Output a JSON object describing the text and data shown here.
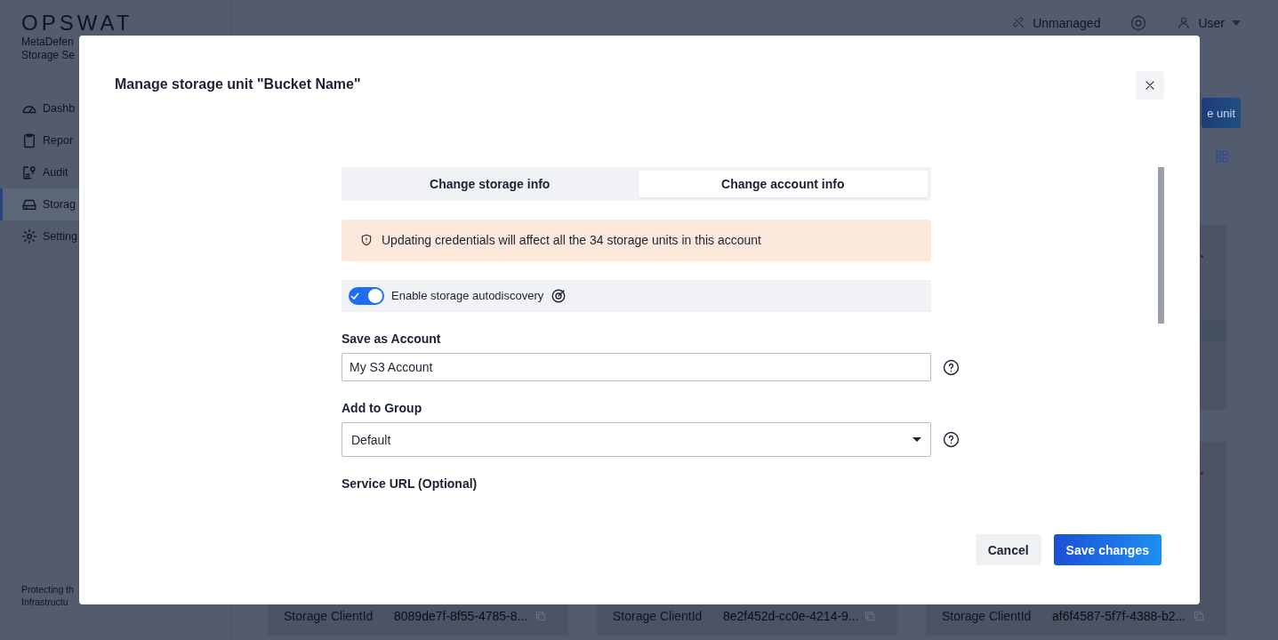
{
  "sidebar": {
    "logo": "OPSWAT",
    "product_lines": [
      "MetaDefen",
      "Storage Se"
    ],
    "items": [
      {
        "label": "Dashb",
        "selected": false
      },
      {
        "label": "Repor",
        "selected": false
      },
      {
        "label": "Audit",
        "selected": false
      },
      {
        "label": "Storag",
        "selected": true
      },
      {
        "label": "Setting",
        "selected": false
      }
    ],
    "footer_lines": [
      "Protecting th",
      "Infrastructu"
    ]
  },
  "header": {
    "mode": "Unmanaged",
    "user": "User"
  },
  "toolbar": {
    "add_button": "e unit"
  },
  "cards": [
    {
      "fields": [
        {
          "label": "Storage ClientId",
          "value": "8089de7f-8f55-4785-8..."
        }
      ]
    },
    {
      "fields": [
        {
          "label": "Storage ClientId",
          "value": "8e2f452d-cc0e-4214-9..."
        }
      ]
    },
    {
      "fields": [
        {
          "label": "Storage ClientId",
          "value": "af6f4587-5f7f-4388-b2..."
        }
      ]
    }
  ],
  "modal": {
    "title": "Manage storage unit \"Bucket Name\"",
    "tabs": [
      {
        "label": "Change storage info",
        "selected": false
      },
      {
        "label": "Change account info",
        "selected": true
      }
    ],
    "alert": "Updating credentials will affect all the 34 storage units in this account",
    "toggle": {
      "label": "Enable storage autodiscovery",
      "on": true
    },
    "fields": [
      {
        "kind": "text",
        "label": "Save as Account",
        "value": "My S3 Account"
      },
      {
        "kind": "select",
        "label": "Add to Group",
        "value": "Default"
      },
      {
        "kind": "label",
        "label": "Service URL (Optional)"
      }
    ],
    "buttons": [
      {
        "kind": "secondary",
        "label": "Cancel"
      },
      {
        "kind": "primary",
        "label": "Save changes"
      }
    ]
  }
}
